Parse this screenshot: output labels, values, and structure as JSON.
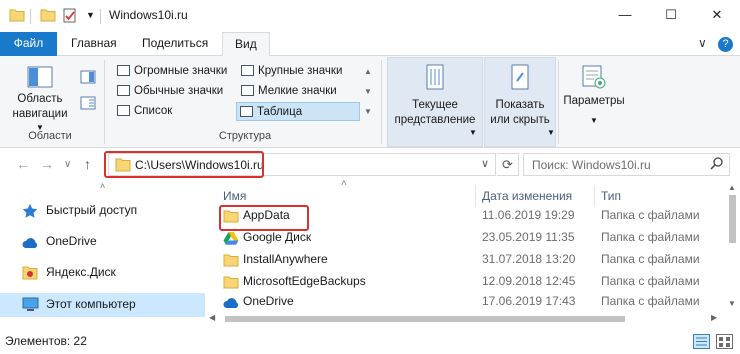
{
  "window": {
    "title": "Windows10i.ru",
    "controls": {
      "minimize": "—",
      "maximize": "☐",
      "close": "✕"
    }
  },
  "ribbon_tabs": [
    "Файл",
    "Главная",
    "Поделиться",
    "Вид"
  ],
  "ribbon_right": {
    "collapse": "∨",
    "help": "?"
  },
  "ribbon": {
    "panes": {
      "nav_pane_label": "Область навигации",
      "group_label": "Области"
    },
    "layout": {
      "items": [
        "Огромные значки",
        "Крупные значки",
        "Обычные значки",
        "Мелкие значки",
        "Список",
        "Таблица"
      ],
      "selected": "Таблица",
      "group_label": "Структура"
    },
    "current_view": {
      "label": "Текущее представление"
    },
    "show_hide": {
      "label": "Показать или скрыть"
    },
    "options": {
      "label": "Параметры"
    }
  },
  "address": {
    "path": "C:\\Users\\Windows10i.ru",
    "search_placeholder": "Поиск: Windows10i.ru"
  },
  "navigation": {
    "back": "←",
    "forward": "→",
    "recent": "∨",
    "up": "↑",
    "items": [
      {
        "label": "Быстрый доступ",
        "icon": "star-icon"
      },
      {
        "label": "OneDrive",
        "icon": "cloud-icon"
      },
      {
        "label": "Яндекс.Диск",
        "icon": "yandex-disk-icon"
      },
      {
        "label": "Этот компьютер",
        "icon": "computer-icon",
        "selected": true
      }
    ]
  },
  "columns": [
    "Имя",
    "Дата изменения",
    "Тип"
  ],
  "files": [
    {
      "name": "AppData",
      "date": "11.06.2019 19:29",
      "type": "Папка с файлами",
      "icon": "folder-icon",
      "highlighted": true
    },
    {
      "name": "Google Диск",
      "date": "23.05.2019 11:35",
      "type": "Папка с файлами",
      "icon": "google-drive-icon"
    },
    {
      "name": "InstallAnywhere",
      "date": "31.07.2018 13:20",
      "type": "Папка с файлами",
      "icon": "folder-icon"
    },
    {
      "name": "MicrosoftEdgeBackups",
      "date": "12.09.2018 12:45",
      "type": "Папка с файлами",
      "icon": "folder-icon"
    },
    {
      "name": "OneDrive",
      "date": "17.06.2019 17:43",
      "type": "Папка с файлами",
      "icon": "cloud-icon"
    }
  ],
  "status": {
    "items_count": "Элементов: 22"
  },
  "colors": {
    "accent": "#1979ca",
    "highlight_red": "#d93030",
    "selection": "#cce8ff",
    "folder": "#f7d675"
  }
}
